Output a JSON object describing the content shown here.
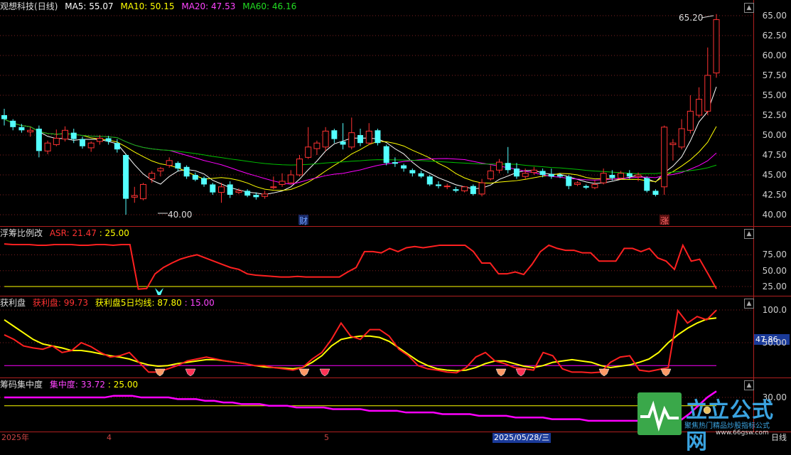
{
  "colors": {
    "bg": "#000000",
    "up": "#ff3232",
    "down": "#54ffff",
    "ma5": "#ffffff",
    "ma10": "#ffff00",
    "ma20": "#ff00ff",
    "ma60": "#00c000",
    "grid": "#802020",
    "axis": "#c0c0c0"
  },
  "main": {
    "stock_name": "观想科技",
    "period": "(日线)",
    "ma5_label": "MA5: 55.07",
    "ma10_label": "MA10: 50.15",
    "ma20_label": "MA20: 47.53",
    "ma60_label": "MA60: 46.16",
    "high_mark": "65.20",
    "low_mark": "40.00",
    "event_cai": "财",
    "event_zhang": "涨",
    "y_ticks": [
      "65.00",
      "62.50",
      "60.00",
      "57.50",
      "55.00",
      "52.50",
      "50.00",
      "47.50",
      "45.00",
      "42.50",
      "40.00"
    ]
  },
  "asr": {
    "title": "浮筹比例改",
    "value_label": "ASR: 21.47",
    "ref_label": ": 25.00",
    "y_ticks": [
      "75.00",
      "50.00",
      "25.00"
    ]
  },
  "profit": {
    "title": "获利盘",
    "value_label": "获利盘: 99.73",
    "ma_label": "获利盘5日均线: 87.80",
    "ref_label": ": 15.00",
    "y_ticks": [
      "100.0",
      "50.00"
    ],
    "cursor_value": "47.86"
  },
  "conc": {
    "title": "筹码集中度",
    "value_label": "集中度: 33.72",
    "ref_label": ": 25.00",
    "y_ticks": [
      "30.00"
    ]
  },
  "bottom": {
    "year": "2025年",
    "month4": "4",
    "month5": "5",
    "date_cursor": "2025/05/28/三",
    "period_label": "日线"
  },
  "logo": {
    "name": "立立公式网",
    "sub": "聚焦热门精品炒股指标公式",
    "url": "www.66gsw.com"
  },
  "chart_data": {
    "type": "candlestick",
    "ylim": [
      39.5,
      66.2
    ],
    "candles": [
      [
        52.5,
        52.0,
        53.3,
        51.2
      ],
      [
        51.8,
        51.0,
        52.0,
        50.6
      ],
      [
        51.0,
        50.6,
        51.4,
        50.3
      ],
      [
        50.4,
        50.6,
        51.0,
        49.8
      ],
      [
        50.8,
        48.0,
        51.2,
        47.2
      ],
      [
        48.0,
        49.0,
        49.3,
        47.6
      ],
      [
        48.8,
        49.6,
        50.7,
        48.6
      ],
      [
        49.5,
        50.6,
        51.1,
        49.2
      ],
      [
        50.3,
        49.5,
        50.8,
        49.0
      ],
      [
        49.5,
        48.6,
        49.8,
        48.3
      ],
      [
        48.4,
        49.0,
        49.2,
        47.9
      ],
      [
        49.2,
        49.6,
        50.0,
        48.8
      ],
      [
        49.6,
        49.2,
        49.9,
        48.8
      ],
      [
        49.0,
        48.2,
        49.5,
        47.8
      ],
      [
        47.5,
        42.0,
        47.6,
        40.0
      ],
      [
        42.2,
        42.4,
        43.5,
        41.5
      ],
      [
        42.0,
        43.8,
        44.0,
        41.8
      ],
      [
        44.5,
        45.2,
        45.5,
        44.0
      ],
      [
        45.5,
        45.8,
        46.0,
        44.8
      ],
      [
        46.2,
        46.8,
        47.2,
        45.9
      ],
      [
        46.5,
        45.8,
        46.7,
        45.5
      ],
      [
        46.0,
        44.8,
        46.2,
        44.5
      ],
      [
        45.0,
        44.4,
        45.3,
        44.2
      ],
      [
        44.6,
        43.8,
        44.8,
        43.5
      ],
      [
        43.8,
        42.8,
        44.0,
        42.5
      ],
      [
        42.8,
        43.5,
        44.0,
        41.5
      ],
      [
        43.8,
        42.5,
        44.2,
        42.1
      ],
      [
        42.8,
        43.0,
        43.3,
        42.6
      ],
      [
        43.0,
        42.4,
        43.2,
        42.2
      ],
      [
        42.5,
        42.2,
        42.8,
        41.9
      ],
      [
        42.3,
        42.6,
        43.0,
        42.0
      ],
      [
        43.4,
        43.5,
        44.8,
        43.2
      ],
      [
        43.8,
        44.2,
        45.2,
        43.5
      ],
      [
        44.0,
        45.0,
        45.6,
        43.8
      ],
      [
        45.0,
        47.0,
        47.5,
        44.8
      ],
      [
        47.2,
        48.5,
        51.0,
        47.0
      ],
      [
        48.3,
        49.0,
        49.3,
        47.5
      ],
      [
        48.5,
        50.5,
        51.0,
        48.0
      ],
      [
        50.6,
        49.5,
        50.8,
        49.0
      ],
      [
        49.2,
        48.8,
        51.5,
        48.2
      ],
      [
        48.5,
        50.3,
        52.2,
        48.2
      ],
      [
        50.0,
        49.0,
        50.8,
        48.6
      ],
      [
        49.0,
        50.5,
        51.5,
        48.8
      ],
      [
        50.6,
        49.0,
        50.8,
        48.7
      ],
      [
        48.6,
        46.5,
        48.8,
        46.2
      ],
      [
        46.6,
        46.4,
        47.2,
        46.0
      ],
      [
        46.2,
        45.8,
        46.4,
        45.4
      ],
      [
        45.6,
        45.2,
        45.8,
        44.8
      ],
      [
        45.2,
        44.8,
        45.5,
        44.6
      ],
      [
        44.8,
        43.8,
        45.0,
        43.6
      ],
      [
        43.8,
        43.6,
        44.2,
        43.3
      ],
      [
        43.6,
        43.6,
        43.9,
        43.2
      ],
      [
        43.2,
        43.0,
        43.5,
        42.8
      ],
      [
        43.0,
        43.5,
        43.6,
        42.8
      ],
      [
        43.6,
        42.6,
        43.8,
        42.4
      ],
      [
        42.6,
        44.0,
        44.5,
        42.3
      ],
      [
        44.5,
        45.5,
        46.2,
        44.3
      ],
      [
        45.6,
        46.6,
        47.0,
        45.2
      ],
      [
        46.5,
        45.6,
        48.5,
        45.2
      ],
      [
        45.8,
        44.8,
        46.5,
        44.5
      ],
      [
        44.8,
        45.2,
        45.8,
        44.5
      ],
      [
        45.3,
        45.6,
        46.0,
        45.0
      ],
      [
        45.5,
        45.0,
        45.8,
        44.7
      ],
      [
        45.1,
        44.8,
        45.8,
        44.5
      ],
      [
        45.0,
        44.8,
        45.2,
        44.6
      ],
      [
        44.8,
        43.6,
        45.0,
        43.2
      ],
      [
        43.8,
        44.0,
        44.2,
        43.6
      ],
      [
        43.6,
        43.4,
        43.8,
        43.2
      ],
      [
        43.4,
        43.8,
        44.3,
        43.2
      ],
      [
        44.0,
        45.2,
        45.8,
        43.8
      ],
      [
        45.0,
        44.6,
        45.6,
        44.3
      ],
      [
        44.6,
        45.2,
        45.5,
        44.5
      ],
      [
        45.2,
        44.8,
        45.6,
        44.5
      ],
      [
        44.8,
        45.0,
        45.3,
        44.2
      ],
      [
        44.6,
        43.0,
        44.8,
        42.8
      ],
      [
        43.0,
        42.5,
        43.2,
        42.3
      ],
      [
        43.5,
        51.0,
        51.2,
        42.5
      ],
      [
        48.8,
        49.0,
        49.5,
        46.8
      ],
      [
        48.5,
        50.8,
        52.0,
        48.2
      ],
      [
        50.6,
        53.0,
        55.0,
        50.2
      ],
      [
        52.5,
        54.5,
        56.0,
        52.2
      ],
      [
        53.0,
        57.5,
        61.0,
        52.5
      ],
      [
        57.8,
        64.5,
        65.2,
        57.2
      ]
    ],
    "asr": [
      92,
      91,
      91,
      91,
      90,
      90,
      91,
      91,
      91,
      90,
      90,
      91,
      91,
      90,
      91,
      91,
      21,
      22,
      45,
      55,
      62,
      68,
      72,
      75,
      70,
      65,
      60,
      55,
      52,
      45,
      43,
      42,
      41,
      40,
      40,
      41,
      40,
      40,
      40,
      40,
      40,
      48,
      55,
      80,
      80,
      78,
      85,
      80,
      86,
      88,
      86,
      88,
      90,
      90,
      90,
      90,
      80,
      62,
      62,
      45,
      45,
      48,
      44,
      60,
      80,
      90,
      85,
      82,
      82,
      78,
      78,
      65,
      65,
      65,
      85,
      85,
      80,
      85,
      70,
      65,
      52,
      90,
      65,
      68,
      45,
      21.47
    ],
    "profit": [
      62,
      55,
      45,
      42,
      40,
      45,
      35,
      38,
      50,
      44,
      35,
      28,
      30,
      35,
      20,
      5,
      5,
      10,
      15,
      22,
      25,
      28,
      25,
      22,
      20,
      18,
      15,
      15,
      12,
      10,
      8,
      12,
      25,
      35,
      55,
      80,
      60,
      55,
      70,
      70,
      60,
      40,
      30,
      15,
      10,
      8,
      5,
      4,
      12,
      28,
      35,
      22,
      18,
      12,
      10,
      8,
      35,
      30,
      10,
      5,
      5,
      4,
      5,
      20,
      28,
      30,
      8,
      6,
      9,
      12,
      99,
      80,
      90,
      85,
      99.73
    ],
    "profit_ma": [
      85,
      75,
      65,
      55,
      48,
      45,
      42,
      38,
      38,
      36,
      33,
      30,
      28,
      25,
      20,
      16,
      14,
      15,
      18,
      20,
      22,
      24,
      24,
      22,
      20,
      18,
      15,
      13,
      12,
      11,
      10,
      12,
      20,
      30,
      45,
      55,
      58,
      60,
      60,
      58,
      52,
      42,
      32,
      22,
      15,
      10,
      8,
      7,
      8,
      12,
      18,
      22,
      22,
      18,
      14,
      12,
      15,
      20,
      22,
      24,
      22,
      20,
      15,
      12,
      14,
      16,
      20,
      25,
      35,
      50,
      62,
      72,
      80,
      86,
      87.8
    ],
    "conc": [
      30,
      30,
      30,
      30,
      30,
      30,
      30,
      30,
      30,
      30,
      30,
      30,
      31,
      31,
      31,
      30,
      30,
      30,
      30,
      29,
      29,
      29,
      28,
      28,
      27,
      27,
      26,
      26,
      26,
      25,
      25,
      25,
      24,
      24,
      24,
      24,
      23,
      23,
      23,
      23,
      22,
      22,
      22,
      22,
      21,
      21,
      21,
      21,
      20,
      20,
      20,
      20,
      19,
      19,
      19,
      19,
      18,
      18,
      18,
      18,
      17,
      17,
      17,
      17,
      16,
      16,
      16,
      16,
      16,
      16,
      16,
      16,
      16,
      16,
      16,
      20,
      25,
      30,
      33.72
    ]
  }
}
